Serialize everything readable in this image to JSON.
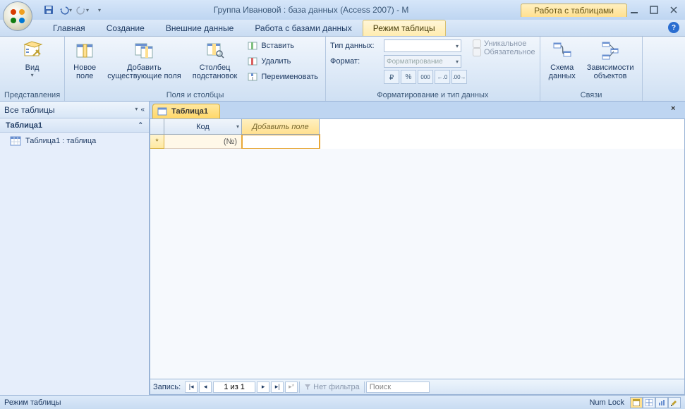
{
  "title": "Группа Ивановой : база данных (Access 2007) - M",
  "context_tab_title": "Работа с таблицами",
  "tabs": {
    "home": "Главная",
    "create": "Создание",
    "external": "Внешние данные",
    "dbtools": "Работа с базами данных",
    "datasheet": "Режим таблицы"
  },
  "ribbon": {
    "views": {
      "label": "Представления",
      "view_btn": "Вид"
    },
    "fields_cols": {
      "label": "Поля и столбцы",
      "new_field": "Новое\nполе",
      "add_existing": "Добавить\nсуществующие поля",
      "lookup_col": "Столбец\nподстановок",
      "insert": "Вставить",
      "delete": "Удалить",
      "rename": "Переименовать"
    },
    "datatype_fmt": {
      "label": "Форматирование и тип данных",
      "datatype_lbl": "Тип данных:",
      "datatype_val": "",
      "format_lbl": "Формат:",
      "format_val": "Форматирование",
      "unique": "Уникальное",
      "required": "Обязательное",
      "btn_currency": "",
      "btn_percent": "%",
      "btn_comma": "000",
      "btn_inc": ".0",
      "btn_dec": ".00"
    },
    "relations": {
      "label": "Связи",
      "schema": "Схема\nданных",
      "deps": "Зависимости\nобъектов"
    }
  },
  "nav": {
    "header": "Все таблицы",
    "group": "Таблица1",
    "item": "Таблица1 : таблица"
  },
  "doc": {
    "tab": "Таблица1",
    "col_id": "Код",
    "col_add": "Добавить поле",
    "cell_newid": "(№)"
  },
  "recnav": {
    "label": "Запись:",
    "pos": "1 из 1",
    "nofilter": "Нет фильтра",
    "search": "Поиск"
  },
  "status": {
    "mode": "Режим таблицы",
    "numlock": "Num Lock"
  }
}
